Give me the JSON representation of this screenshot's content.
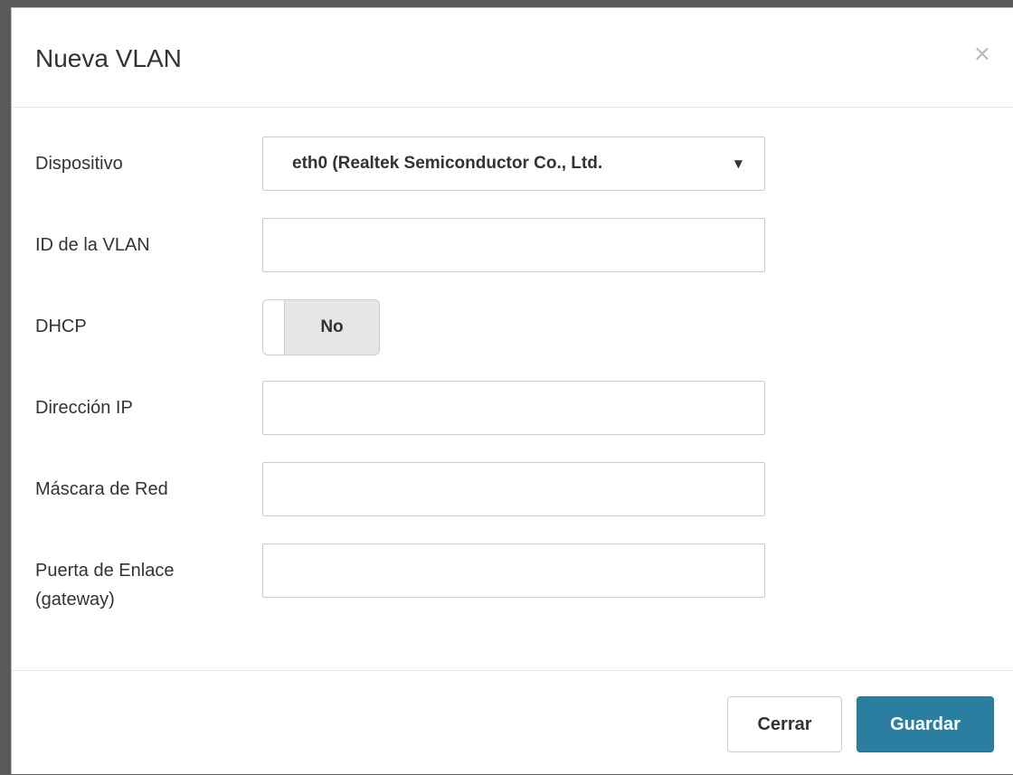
{
  "modal": {
    "title": "Nueva VLAN",
    "close_glyph": "×"
  },
  "form": {
    "device": {
      "label": "Dispositivo",
      "selected": "eth0 (Realtek Semiconductor Co., Ltd.",
      "arrow_glyph": "▼"
    },
    "vlan_id": {
      "label": "ID de la VLAN",
      "value": "",
      "placeholder": ""
    },
    "dhcp": {
      "label": "DHCP",
      "state": "No"
    },
    "ip_address": {
      "label": "Dirección IP",
      "value": "",
      "placeholder": ""
    },
    "netmask": {
      "label": "Máscara de Red",
      "value": "",
      "placeholder": ""
    },
    "gateway": {
      "label_line1": "Puerta de Enlace",
      "label_line2": "(gateway)",
      "value": "",
      "placeholder": ""
    }
  },
  "footer": {
    "close_label": "Cerrar",
    "save_label": "Guardar"
  },
  "colors": {
    "primary": "#2a7fa0",
    "backdrop": "#5a5a5a"
  }
}
